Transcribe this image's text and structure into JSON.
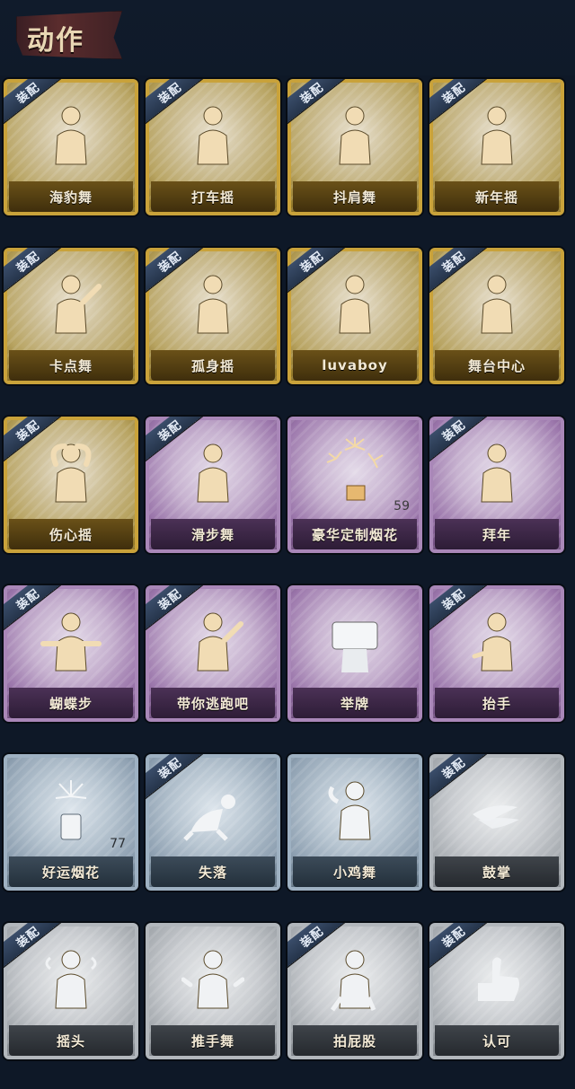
{
  "header": {
    "title": "动作"
  },
  "badge_label": "装配",
  "colors": {
    "background": "#0e1827",
    "gold": "#c9a23a",
    "purple": "#a987b8",
    "blue": "#9eb1c2",
    "grey": "#b2b7bc",
    "badge": "#2e4260"
  },
  "items": [
    {
      "name": "海豹舞",
      "tier": "gold",
      "equipped": true,
      "icon": "dance-figure-icon"
    },
    {
      "name": "打车摇",
      "tier": "gold",
      "equipped": true,
      "icon": "dance-figure-icon"
    },
    {
      "name": "抖肩舞",
      "tier": "gold",
      "equipped": true,
      "icon": "dance-figure-icon"
    },
    {
      "name": "新年摇",
      "tier": "gold",
      "equipped": true,
      "icon": "dance-figure-icon"
    },
    {
      "name": "卡点舞",
      "tier": "gold",
      "equipped": true,
      "icon": "pointing-figure-icon"
    },
    {
      "name": "孤身摇",
      "tier": "gold",
      "equipped": true,
      "icon": "dance-figure-icon"
    },
    {
      "name": "luvaboy",
      "tier": "gold",
      "equipped": true,
      "icon": "dance-figure-icon"
    },
    {
      "name": "舞台中心",
      "tier": "gold",
      "equipped": true,
      "icon": "dance-figure-icon"
    },
    {
      "name": "伤心摇",
      "tier": "gold",
      "equipped": true,
      "icon": "heart-hands-figure-icon"
    },
    {
      "name": "滑步舞",
      "tier": "purple",
      "equipped": true,
      "icon": "dance-figure-icon"
    },
    {
      "name": "豪华定制烟花",
      "tier": "purple",
      "equipped": false,
      "icon": "firework-box-icon",
      "count": "59"
    },
    {
      "name": "拜年",
      "tier": "purple",
      "equipped": true,
      "icon": "bow-figure-icon"
    },
    {
      "name": "蝴蝶步",
      "tier": "purple",
      "equipped": true,
      "icon": "arms-out-figure-icon"
    },
    {
      "name": "带你逃跑吧",
      "tier": "purple",
      "equipped": true,
      "icon": "pointing-figure-icon"
    },
    {
      "name": "举牌",
      "tier": "purple",
      "equipped": false,
      "icon": "sign-holding-icon"
    },
    {
      "name": "抬手",
      "tier": "purple",
      "equipped": true,
      "icon": "raise-hand-icon"
    },
    {
      "name": "好运烟花",
      "tier": "blue",
      "equipped": false,
      "icon": "firework-can-icon",
      "count": "77"
    },
    {
      "name": "失落",
      "tier": "blue",
      "equipped": true,
      "icon": "kneeling-figure-icon"
    },
    {
      "name": "小鸡舞",
      "tier": "blue",
      "equipped": false,
      "icon": "chicken-dance-icon"
    },
    {
      "name": "鼓掌",
      "tier": "grey",
      "equipped": true,
      "icon": "clapping-hands-icon"
    },
    {
      "name": "摇头",
      "tier": "grey",
      "equipped": true,
      "icon": "head-shake-icon"
    },
    {
      "name": "推手舞",
      "tier": "grey",
      "equipped": false,
      "icon": "push-hands-icon"
    },
    {
      "name": "拍屁股",
      "tier": "grey",
      "equipped": true,
      "icon": "butt-slap-icon"
    },
    {
      "name": "认可",
      "tier": "grey",
      "equipped": true,
      "icon": "thumbs-up-icon"
    }
  ]
}
